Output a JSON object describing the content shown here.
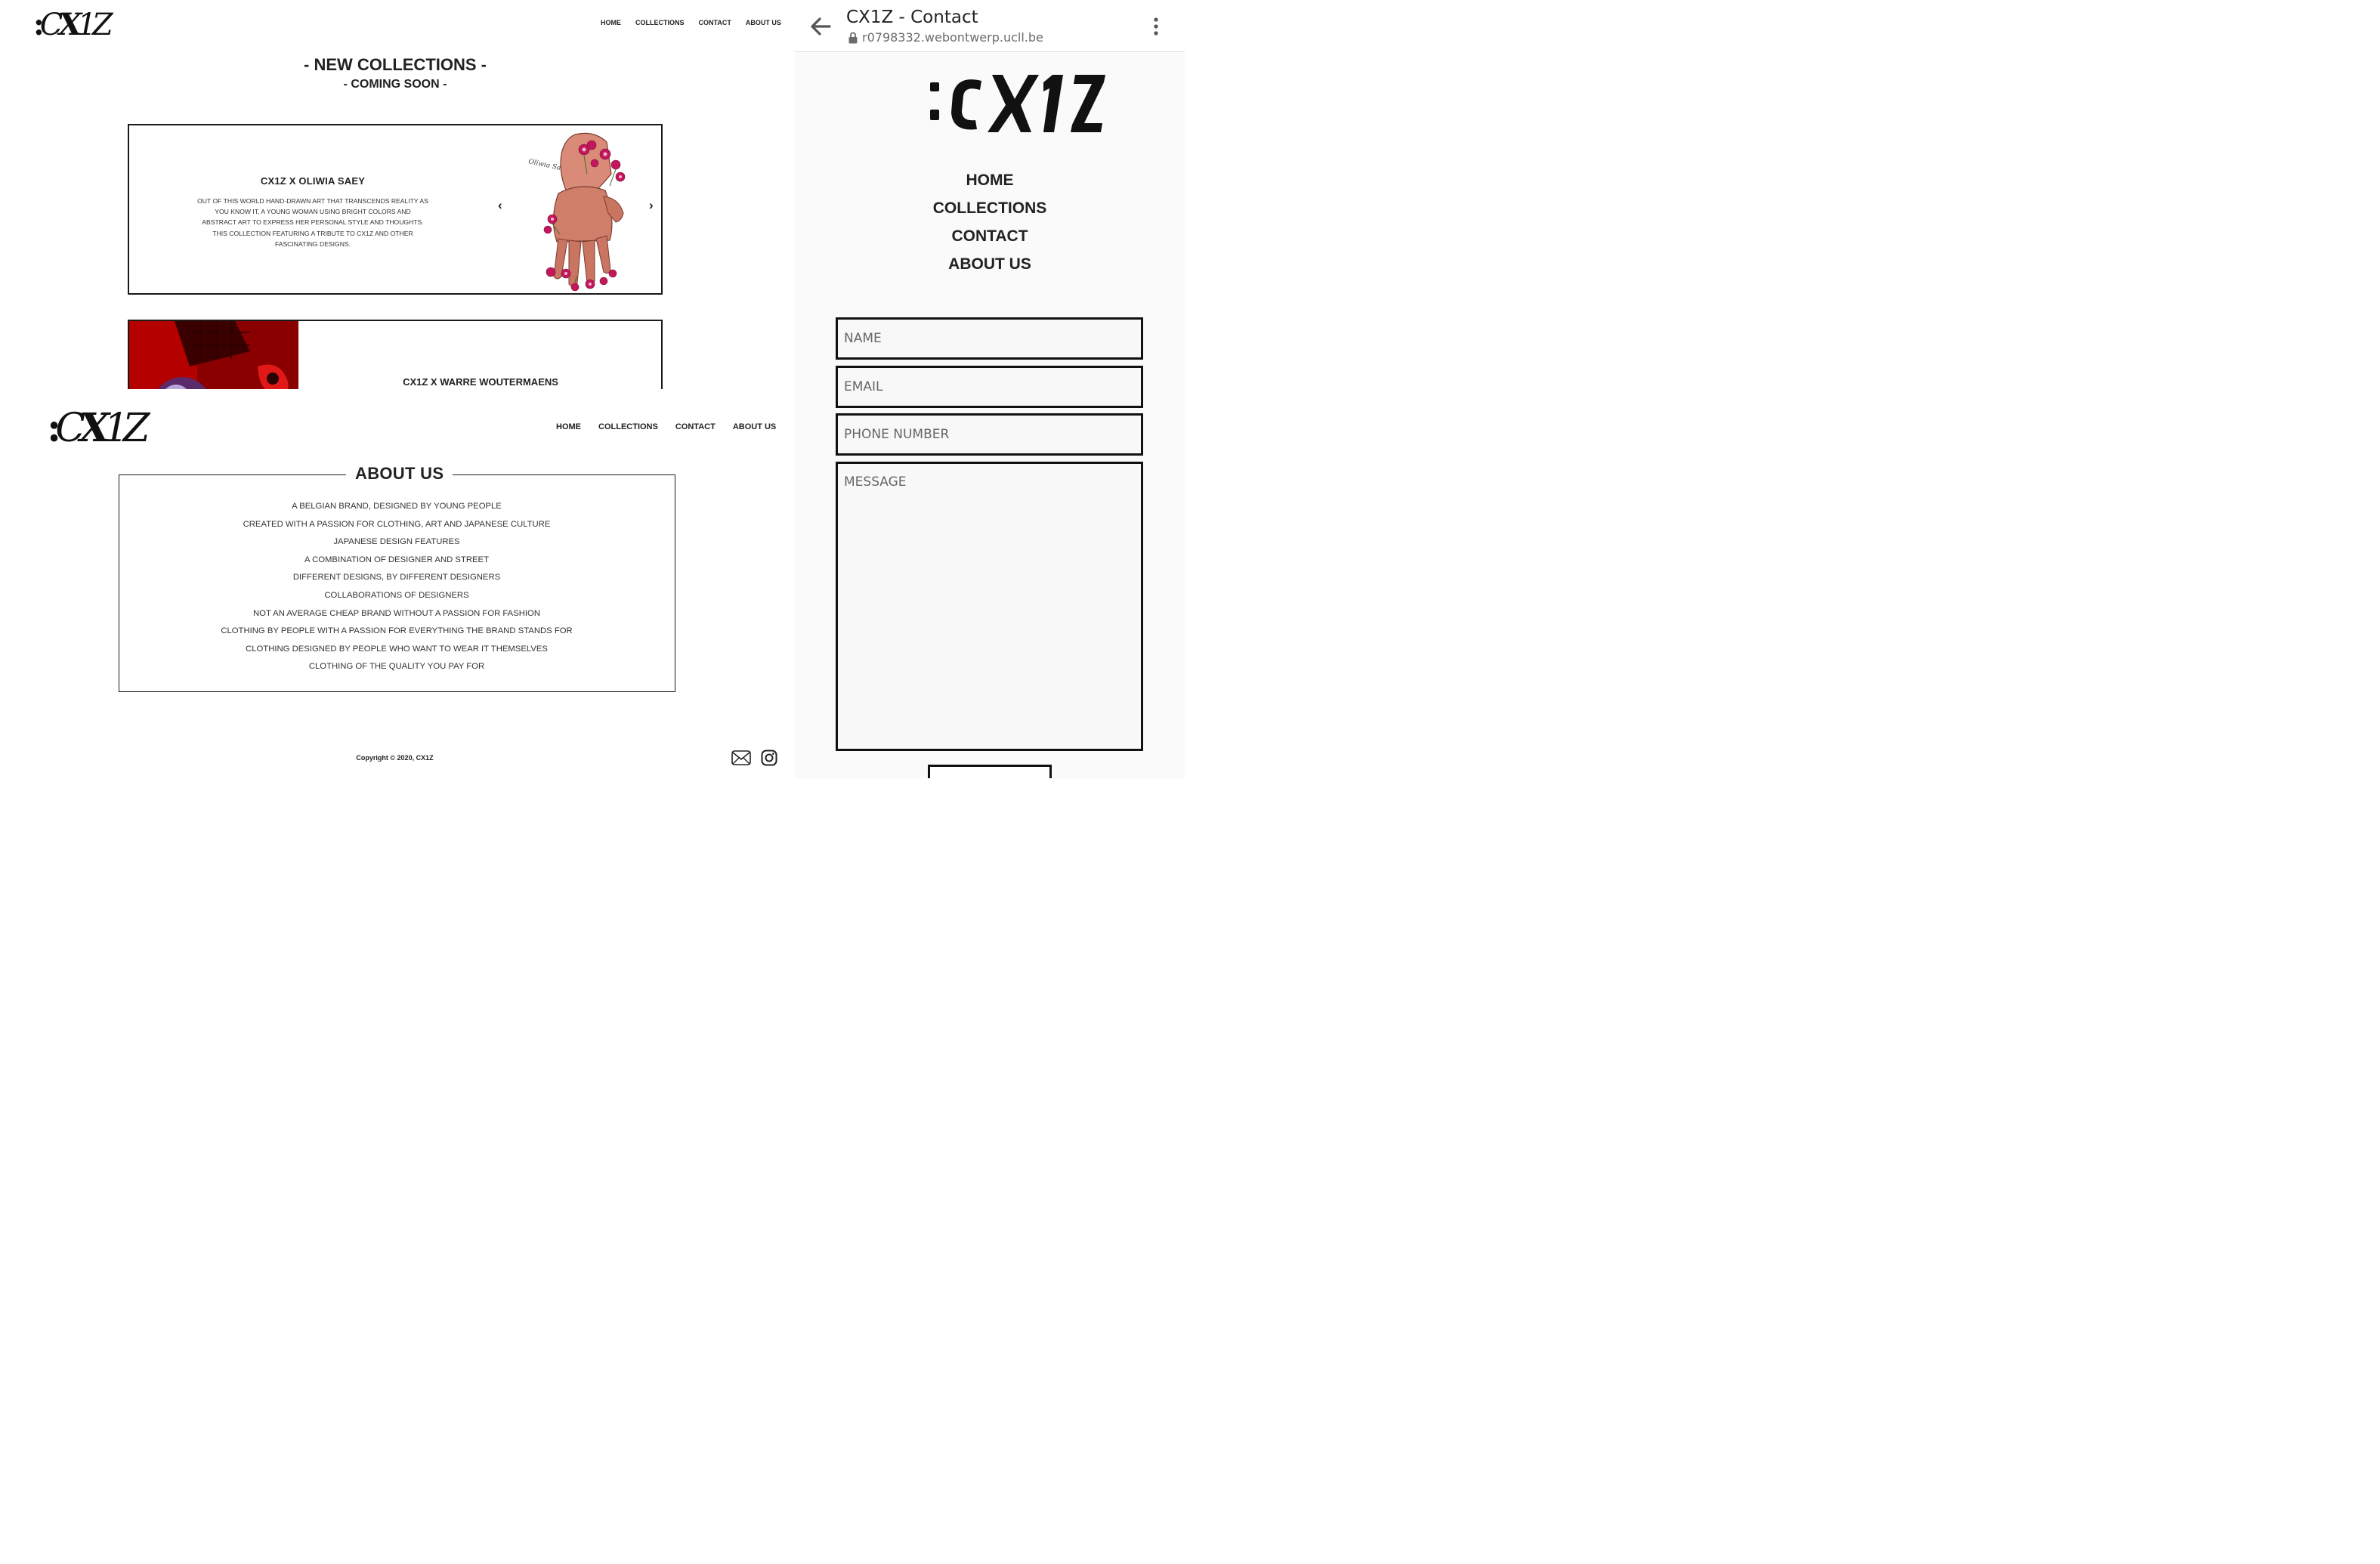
{
  "desktop_collections": {
    "logo_text": ":CX1Z",
    "nav": [
      "HOME",
      "COLLECTIONS",
      "CONTACT",
      "ABOUT US"
    ],
    "heading": "- NEW COLLECTIONS -",
    "subheading": "- COMING SOON -",
    "cards": [
      {
        "title": "CX1Z X OLIWIA SAEY",
        "description": "OUT OF THIS WORLD HAND-DRAWN ART THAT TRANSCENDS REALITY AS YOU KNOW IT, A YOUNG WOMAN USING BRIGHT COLORS AND ABSTRACT ART TO EXPRESS HER PERSONAL STYLE AND THOUGHTS. THIS COLLECTION FEATURING A TRIBUTE TO CX1Z AND OTHER FASCINATING DESIGNS.",
        "image_signature": "Oliwia Saey",
        "prev_arrow": "‹",
        "next_arrow": "›"
      },
      {
        "title": "CX1Z X WARRE WOUTERMAENS"
      }
    ]
  },
  "desktop_about": {
    "logo_text": ":CX1Z",
    "nav": [
      "HOME",
      "COLLECTIONS",
      "CONTACT",
      "ABOUT US"
    ],
    "title": "ABOUT US",
    "lines": [
      "A BELGIAN BRAND, DESIGNED BY YOUNG PEOPLE",
      "CREATED WITH A PASSION FOR CLOTHING, ART AND JAPANESE CULTURE",
      "JAPANESE DESIGN FEATURES",
      "A COMBINATION OF DESIGNER AND STREET",
      "DIFFERENT DESIGNS, BY DIFFERENT DESIGNERS",
      "COLLABORATIONS OF DESIGNERS",
      "NOT AN AVERAGE CHEAP BRAND WITHOUT A PASSION FOR FASHION",
      "CLOTHING BY PEOPLE WITH A PASSION FOR EVERYTHING THE BRAND STANDS FOR",
      "CLOTHING DESIGNED BY PEOPLE WHO WANT TO WEAR IT THEMSELVES",
      "CLOTHING OF THE QUALITY YOU PAY FOR"
    ],
    "footer": {
      "copyright": "Copyright © 2020, CX1Z",
      "icons": [
        "mail-icon",
        "instagram-icon"
      ]
    }
  },
  "mobile_contact": {
    "browser": {
      "page_title": "CX1Z - Contact",
      "url": "r0798332.webontwerp.ucll.be",
      "icons": [
        "back-arrow-icon",
        "lock-icon",
        "more-vertical-icon"
      ]
    },
    "logo_text": ":CX1Z",
    "nav": [
      "HOME",
      "COLLECTIONS",
      "CONTACT",
      "ABOUT US"
    ],
    "form": {
      "name_placeholder": "NAME",
      "email_placeholder": "EMAIL",
      "phone_placeholder": "PHONE NUMBER",
      "message_placeholder": "MESSAGE"
    }
  },
  "colors": {
    "text": "#222222",
    "border": "#111111",
    "muted_url": "#6b6b6b",
    "panel_bg": "#fafafa",
    "accent_pink": "#c2185b",
    "accent_red": "#e01818"
  }
}
